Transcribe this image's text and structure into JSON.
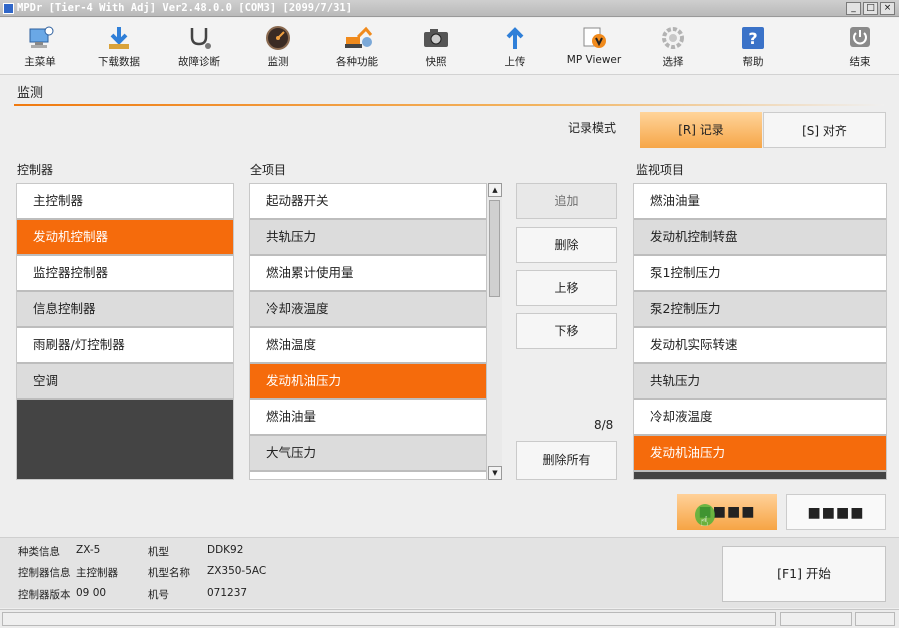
{
  "window": {
    "title": "MPDr [Tier-4 With Adj] Ver2.48.0.0 [COM3] [2099/7/31]",
    "controls": [
      "_",
      "□",
      "×"
    ]
  },
  "toolbar": [
    {
      "label": "主菜单",
      "icon": "home-computer-icon"
    },
    {
      "label": "下载数据",
      "icon": "download-icon"
    },
    {
      "label": "故障诊断",
      "icon": "stethoscope-icon"
    },
    {
      "label": "监测",
      "icon": "gauge-icon"
    },
    {
      "label": "各种功能",
      "icon": "excavator-icon"
    },
    {
      "label": "快照",
      "icon": "camera-icon"
    },
    {
      "label": "上传",
      "icon": "upload-icon"
    },
    {
      "label": "MP Viewer",
      "icon": "viewer-icon"
    },
    {
      "label": "选择",
      "icon": "gear-icon"
    },
    {
      "label": "帮助",
      "icon": "help-icon"
    },
    {
      "label": "结束",
      "icon": "power-icon"
    }
  ],
  "page": {
    "title": "监测"
  },
  "record_mode": {
    "label": "记录模式",
    "options": [
      "[R] 记录",
      "[S] 对齐"
    ],
    "selected": 0
  },
  "controllers": {
    "heading": "控制器",
    "items": [
      "主控制器",
      "发动机控制器",
      "监控器控制器",
      "信息控制器",
      "雨刷器/灯控制器",
      "空调"
    ],
    "selected": 1
  },
  "all_items": {
    "heading": "全项目",
    "items": [
      "起动器开关",
      "共轨压力",
      "燃油累计使用量",
      "冷却液温度",
      "燃油温度",
      "发动机油压力",
      "燃油油量",
      "大气压力"
    ],
    "selected": 5
  },
  "actions": {
    "add": "追加",
    "delete": "删除",
    "move_up": "上移",
    "move_down": "下移",
    "count": "8/8",
    "delete_all": "删除所有"
  },
  "monitor_items": {
    "heading": "监视项目",
    "items": [
      "燃油油量",
      "发动机控制转盘",
      "泵1控制压力",
      "泵2控制压力",
      "发动机实际转速",
      "共轨压力",
      "冷却液温度",
      "发动机油压力"
    ],
    "selected": 7
  },
  "bottom_buttons": {
    "left": "■■■■",
    "right": "■■■■"
  },
  "info": {
    "kind_label": "种类信息",
    "kind_value": "ZX-5",
    "ctrl_label": "控制器信息",
    "ctrl_value": "主控制器",
    "ver_label": "控制器版本",
    "ver_value": "09 00",
    "model_label": "机型",
    "model_value": "DDK92",
    "model_name_label": "机型名称",
    "model_name_value": "ZX350-5AC",
    "number_label": "机号",
    "number_value": "071237"
  },
  "start_button": "[F1] 开始",
  "colors": {
    "accent": "#f56b0c",
    "accent_light": "#f6a648"
  }
}
